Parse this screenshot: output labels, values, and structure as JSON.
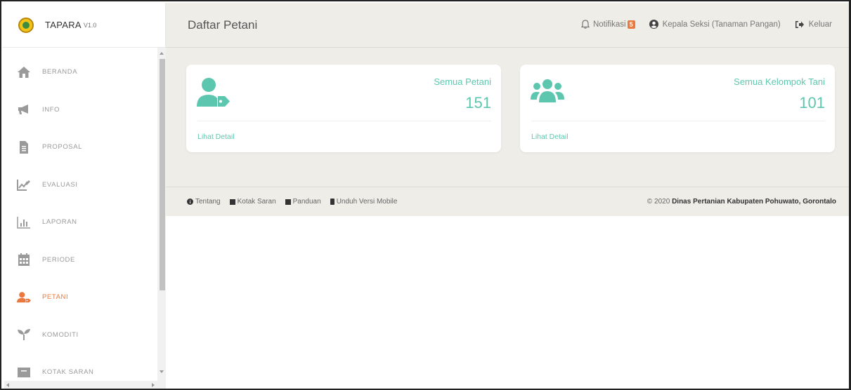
{
  "app": {
    "name": "TAPARA",
    "version": "V1.0"
  },
  "sidebar": {
    "items": [
      {
        "label": "BERANDA",
        "icon": "home-icon",
        "active": false
      },
      {
        "label": "INFO",
        "icon": "megaphone-icon",
        "active": false
      },
      {
        "label": "PROPOSAL",
        "icon": "document-icon",
        "active": false
      },
      {
        "label": "EVALUASI",
        "icon": "chart-edit-icon",
        "active": false
      },
      {
        "label": "LAPORAN",
        "icon": "bar-chart-icon",
        "active": false
      },
      {
        "label": "PERIODE",
        "icon": "calendar-icon",
        "active": false
      },
      {
        "label": "PETANI",
        "icon": "user-tag-icon",
        "active": true
      },
      {
        "label": "KOMODITI",
        "icon": "seedling-icon",
        "active": false
      },
      {
        "label": "KOTAK SARAN",
        "icon": "inbox-icon",
        "active": false
      }
    ]
  },
  "header": {
    "title": "Daftar Petani",
    "notification_label": "Notifikasi",
    "notification_count": "5",
    "user_label": "Kepala Seksi (Tanaman Pangan)",
    "logout_label": "Keluar"
  },
  "cards": [
    {
      "title": "Semua Petani",
      "value": "151",
      "link": "Lihat Detail",
      "icon": "user-tag-icon"
    },
    {
      "title": "Semua Kelompok Tani",
      "value": "101",
      "link": "Lihat Detail",
      "icon": "users-icon"
    }
  ],
  "footer": {
    "links": [
      "Tentang",
      "Kotak Saran",
      "Panduan",
      "Unduh Versi Mobile"
    ],
    "copyright_prefix": "© 2020",
    "copyright_org": "Dinas Pertanian Kabupaten Pohuwato, Gorontalo"
  },
  "colors": {
    "accent": "#5cc7ae",
    "active": "#e9793f",
    "background": "#eeede8"
  }
}
